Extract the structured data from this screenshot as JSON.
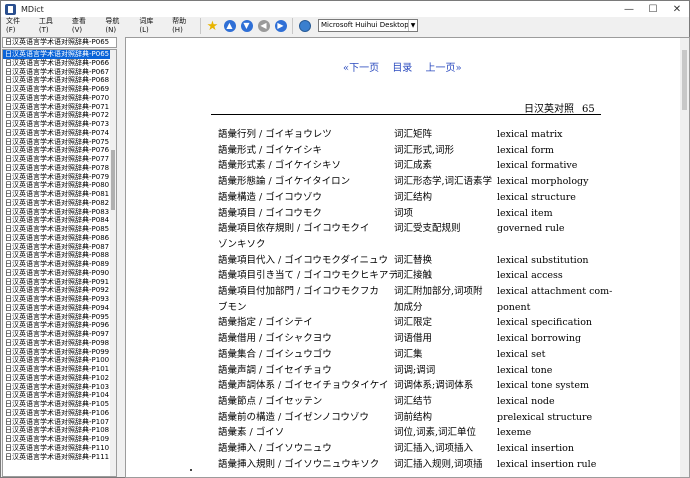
{
  "window": {
    "title": "MDict"
  },
  "menu": [
    {
      "id": "file",
      "label": "文件 (F)"
    },
    {
      "id": "tools",
      "label": "工具 (T)"
    },
    {
      "id": "view",
      "label": "查看 (V)"
    },
    {
      "id": "nav",
      "label": "导航 (N)"
    },
    {
      "id": "library",
      "label": "词库 (L)"
    },
    {
      "id": "help",
      "label": "帮助 (H)"
    }
  ],
  "toolbar": {
    "icons": [
      "star-icon",
      "back-icon",
      "forward-icon",
      "prev-icon",
      "next-icon",
      "globe-icon"
    ],
    "font_select": "Microsoft Huihui Desktop - C"
  },
  "search": {
    "value": "日汉英语言学术语对照辞典-P065"
  },
  "sidebar": {
    "items": [
      "日汉英语言学术语对照辞典-P065",
      "日汉英语言学术语对照辞典-P066",
      "日汉英语言学术语对照辞典-P067",
      "日汉英语言学术语对照辞典-P068",
      "日汉英语言学术语对照辞典-P069",
      "日汉英语言学术语对照辞典-P070",
      "日汉英语言学术语对照辞典-P071",
      "日汉英语言学术语对照辞典-P072",
      "日汉英语言学术语对照辞典-P073",
      "日汉英语言学术语对照辞典-P074",
      "日汉英语言学术语对照辞典-P075",
      "日汉英语言学术语对照辞典-P076",
      "日汉英语言学术语对照辞典-P077",
      "日汉英语言学术语对照辞典-P078",
      "日汉英语言学术语对照辞典-P079",
      "日汉英语言学术语对照辞典-P080",
      "日汉英语言学术语对照辞典-P081",
      "日汉英语言学术语对照辞典-P082",
      "日汉英语言学术语对照辞典-P083",
      "日汉英语言学术语对照辞典-P084",
      "日汉英语言学术语对照辞典-P085",
      "日汉英语言学术语对照辞典-P086",
      "日汉英语言学术语对照辞典-P087",
      "日汉英语言学术语对照辞典-P088",
      "日汉英语言学术语对照辞典-P089",
      "日汉英语言学术语对照辞典-P090",
      "日汉英语言学术语对照辞典-P091",
      "日汉英语言学术语对照辞典-P092",
      "日汉英语言学术语对照辞典-P093",
      "日汉英语言学术语对照辞典-P094",
      "日汉英语言学术语对照辞典-P095",
      "日汉英语言学术语对照辞典-P096",
      "日汉英语言学术语对照辞典-P097",
      "日汉英语言学术语对照辞典-P098",
      "日汉英语言学术语对照辞典-P099",
      "日汉英语言学术语对照辞典-P100",
      "日汉英语言学术语对照辞典-P101",
      "日汉英语言学术语对照辞典-P102",
      "日汉英语言学术语对照辞典-P103",
      "日汉英语言学术语对照辞典-P104",
      "日汉英语言学术语对照辞典-P105",
      "日汉英语言学术语对照辞典-P106",
      "日汉英语言学术语对照辞典-P107",
      "日汉英语言学术语对照辞典-P108",
      "日汉英语言学术语对照辞典-P109",
      "日汉英语言学术语对照辞典-P110",
      "日汉英语言学术语对照辞典-P111"
    ],
    "selected_index": 0
  },
  "content": {
    "nav": {
      "next": "«下一页",
      "index": "目录",
      "prev": "上一页»"
    },
    "header": {
      "title": "日汉英对照",
      "page": "65"
    },
    "entries": [
      {
        "jp": "語彙行列 / ゴイギョウレツ",
        "zh": "词汇矩阵",
        "en": "lexical matrix"
      },
      {
        "jp": "語彙形式 / ゴイケイシキ",
        "zh": "词汇形式,词形",
        "en": "lexical form"
      },
      {
        "jp": "語彙形式素 / ゴイケイシキソ",
        "zh": "词汇成素",
        "en": "lexical formative"
      },
      {
        "jp": "語彙形態論 / ゴイケイタイロン",
        "zh": "词汇形态学,词汇语素学",
        "en": "lexical morphology"
      },
      {
        "jp": "語彙構造 / ゴイコウゾウ",
        "zh": "词汇结构",
        "en": "lexical structure"
      },
      {
        "jp": "語彙項目 / ゴイコウモク",
        "zh": "词项",
        "en": "lexical item"
      },
      {
        "jp": "語彙項目依存規則 / ゴイコウモクイ",
        "zh": "词汇受支配规则",
        "en": "governed rule"
      },
      {
        "jp": "ゾンキソク",
        "zh": "",
        "en": ""
      },
      {
        "jp": "語彙項目代入 / ゴイコウモクダイニュウ",
        "zh": "词汇替换",
        "en": "lexical substitution"
      },
      {
        "jp": "語彙項目引き当て / ゴイコウモクヒキアテ",
        "zh": "词汇接触",
        "en": "lexical access"
      },
      {
        "jp": "語彙項目付加部門 / ゴイコウモクフカ",
        "zh": "词汇附加部分,词项附",
        "en": "lexical attachment com-"
      },
      {
        "jp": "ブモン",
        "zh": "加成分",
        "en": "ponent"
      },
      {
        "jp": "語彙指定 / ゴイシテイ",
        "zh": "词汇限定",
        "en": "lexical specification"
      },
      {
        "jp": "語彙借用 / ゴイシャクヨウ",
        "zh": "词语借用",
        "en": "lexical borrowing"
      },
      {
        "jp": "語彙集合 / ゴイシュウゴウ",
        "zh": "词汇集",
        "en": "lexical set"
      },
      {
        "jp": "語彙声調 / ゴイセイチョウ",
        "zh": "词调;调词",
        "en": "lexical tone"
      },
      {
        "jp": "語彙声調体系 / ゴイセイチョウタイケイ",
        "zh": "词调体系;调词体系",
        "en": "lexical tone system"
      },
      {
        "jp": "語彙節点 / ゴイセッテン",
        "zh": "词汇结节",
        "en": "lexical node"
      },
      {
        "jp": "語彙前の構造 / ゴイゼンノコウゾウ",
        "zh": "词前结构",
        "en": "prelexical structure"
      },
      {
        "jp": "語彙素 / ゴイソ",
        "zh": "词位,词素,词汇单位",
        "en": "lexeme"
      },
      {
        "jp": "語彙挿入 / ゴイソウニュウ",
        "zh": "词汇插入,词项插入",
        "en": "lexical insertion"
      },
      {
        "jp": "語彙挿入規則 / ゴイソウニュウキソク",
        "zh": "词汇插入规则,词项插",
        "en": "lexical insertion rule"
      }
    ]
  }
}
